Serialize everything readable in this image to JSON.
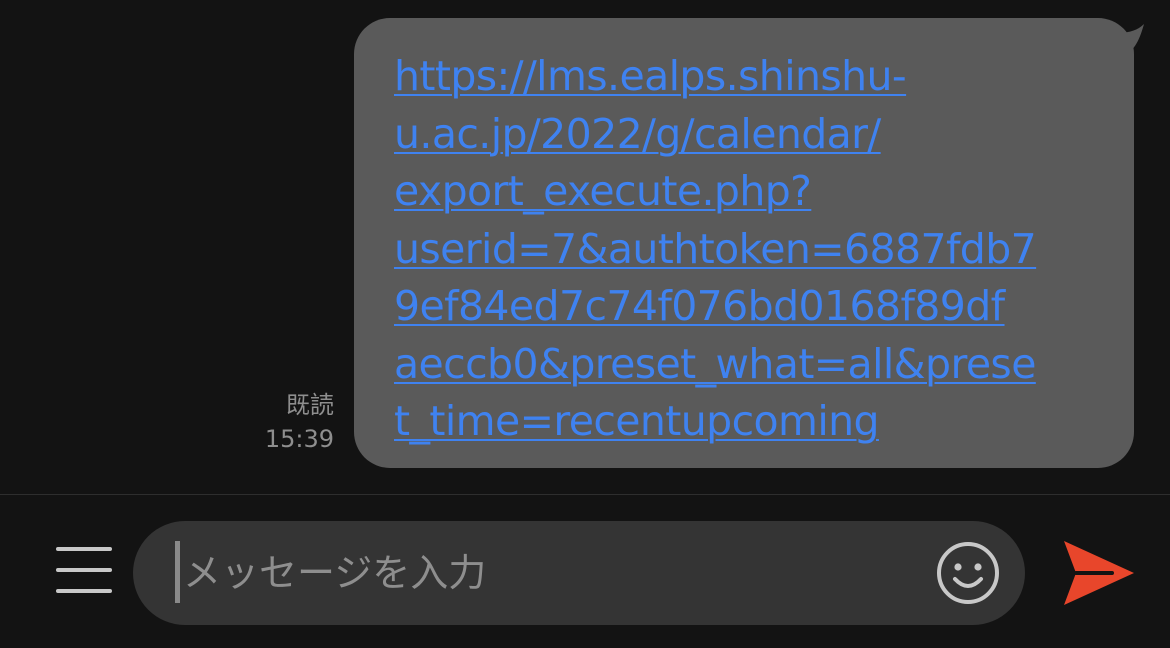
{
  "message": {
    "link_lines": [
      "https://lms.ealps.shinshu-",
      "u.ac.jp/2022/g/calendar/",
      "export_execute.php?",
      "userid=7&authtoken=6887fdb7",
      "9ef84ed7c74f076bd0168f89df",
      "aeccb0&preset_what=all&prese",
      "t_time=recentupcoming"
    ],
    "read_label": "既読",
    "time": "15:39"
  },
  "composer": {
    "placeholder": "メッセージを入力",
    "menu_icon": "hamburger-icon",
    "emoji_icon": "smiley-icon",
    "send_icon": "send-arrow-icon"
  },
  "colors": {
    "background": "#131313",
    "bubble": "#5a5a5a",
    "link": "#3f82f0",
    "input_field": "#343434",
    "send_accent": "#e8462b"
  }
}
